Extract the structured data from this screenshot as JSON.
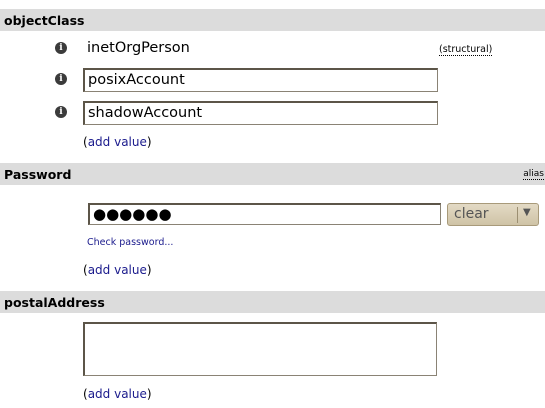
{
  "object_class": {
    "title": "objectClass",
    "values": [
      "inetOrgPerson",
      "posixAccount",
      "shadowAccount"
    ],
    "structural_label": "(structural)",
    "info_icon": "info-icon",
    "add_value": {
      "open": "(",
      "link": "add value",
      "close": ")"
    }
  },
  "password": {
    "title": "Password",
    "alias_label": "alias",
    "masked_value": "●●●●●●",
    "hash_select": {
      "selected": "clear",
      "icon": "chevron-down-icon"
    },
    "check_password_link": "Check password...",
    "add_value": {
      "open": "(",
      "link": "add value",
      "close": ")"
    }
  },
  "postal_address": {
    "title": "postalAddress",
    "value": "",
    "add_value": {
      "open": "(",
      "link": "add value",
      "close": ")"
    }
  },
  "colors": {
    "header_bg": "#dcdcdc",
    "link": "#1a1a8c",
    "select_bg": "#d9cfb8"
  }
}
